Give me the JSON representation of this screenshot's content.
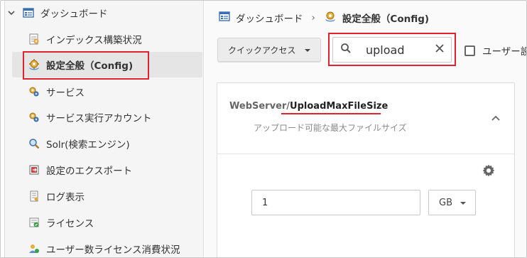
{
  "sidebar": {
    "root_label": "ダッシュボード",
    "items": [
      {
        "label": "インデックス構築状況",
        "icon": "index-build-icon"
      },
      {
        "label": "設定全般（Config)",
        "icon": "config-icon"
      },
      {
        "label": "サービス",
        "icon": "service-icon"
      },
      {
        "label": "サービス実行アカウント",
        "icon": "service-account-icon"
      },
      {
        "label": "Solr(検索エンジン)",
        "icon": "search-engine-icon"
      },
      {
        "label": "設定のエクスポート",
        "icon": "export-icon"
      },
      {
        "label": "ログ表示",
        "icon": "log-icon"
      },
      {
        "label": "ライセンス",
        "icon": "license-icon"
      },
      {
        "label": "ユーザー数ライセンス消費状況",
        "icon": "user-license-icon"
      }
    ],
    "active_index": 1
  },
  "breadcrumb": {
    "root": "ダッシュボード",
    "separator": "›",
    "current": "設定全般（Config)"
  },
  "toolbar": {
    "quick_access_label": "クイックアクセス",
    "search_value": "upload",
    "checkbox_label": "ユーザー設"
  },
  "setting": {
    "title_prefix": "WebServer/",
    "title_name": "UploadMaxFileSize",
    "description": "アップロード可能な最大ファイルサイズ",
    "value": "1",
    "unit": "GB"
  },
  "colors": {
    "highlight": "#e0232e"
  }
}
